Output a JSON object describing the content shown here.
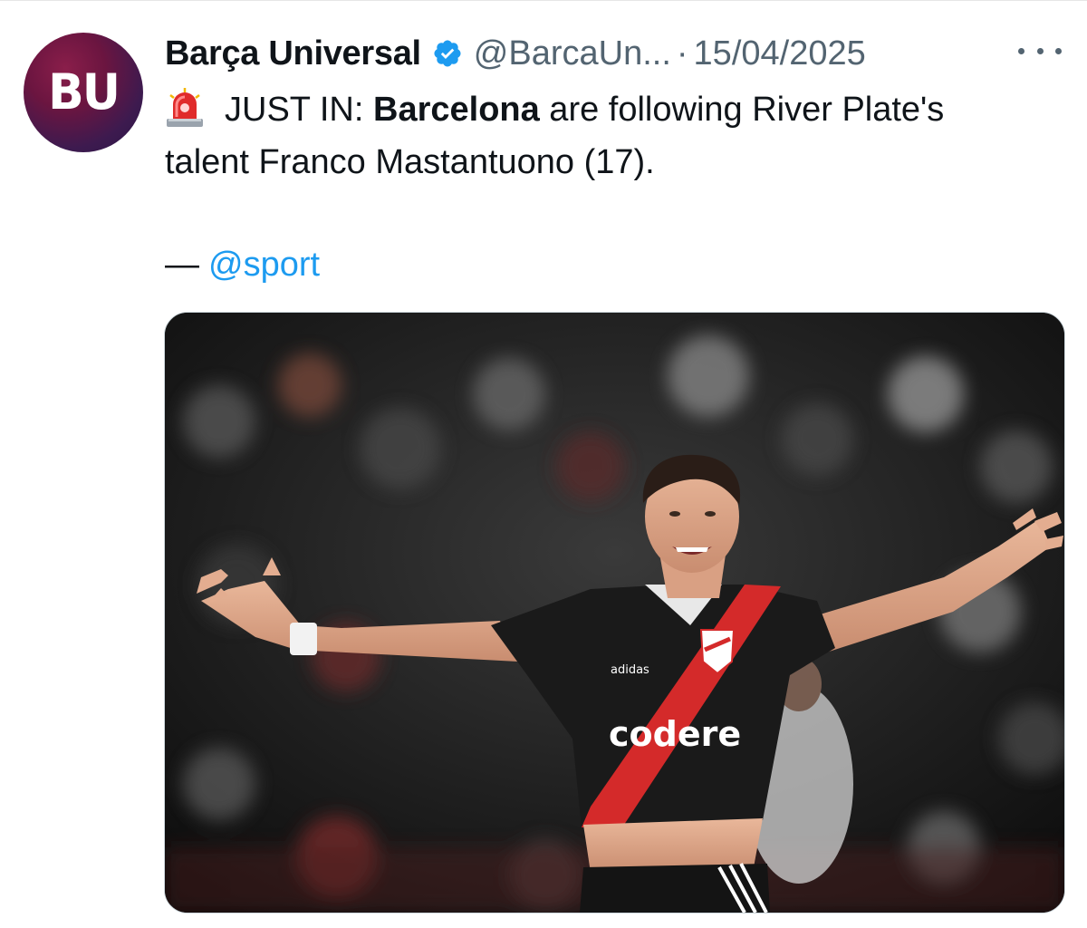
{
  "tweet": {
    "author": {
      "display_name": "Barça Universal",
      "handle": "@BarcaUn...",
      "avatar_text": "BU",
      "verified": true,
      "verified_color": "#1d9bf0"
    },
    "separator": "·",
    "date": "15/04/2025",
    "more_icon": "more-horizontal-icon",
    "text": {
      "siren_icon": "siren-emoji-icon",
      "prefix": "JUST IN: ",
      "bold": "Barcelona",
      "rest_line1": " are following River Plate's",
      "line2": "talent Franco Mastantuono (17)."
    },
    "credit": {
      "dash": "—",
      "link": "@sport",
      "link_color": "#1d9bf0"
    },
    "media": {
      "description_icon": "photo-icon",
      "shirt_sponsor": "codere",
      "shirt_brand": "adidas"
    }
  },
  "colors": {
    "text_primary": "#0f1419",
    "text_secondary": "#536471",
    "accent": "#1d9bf0"
  }
}
